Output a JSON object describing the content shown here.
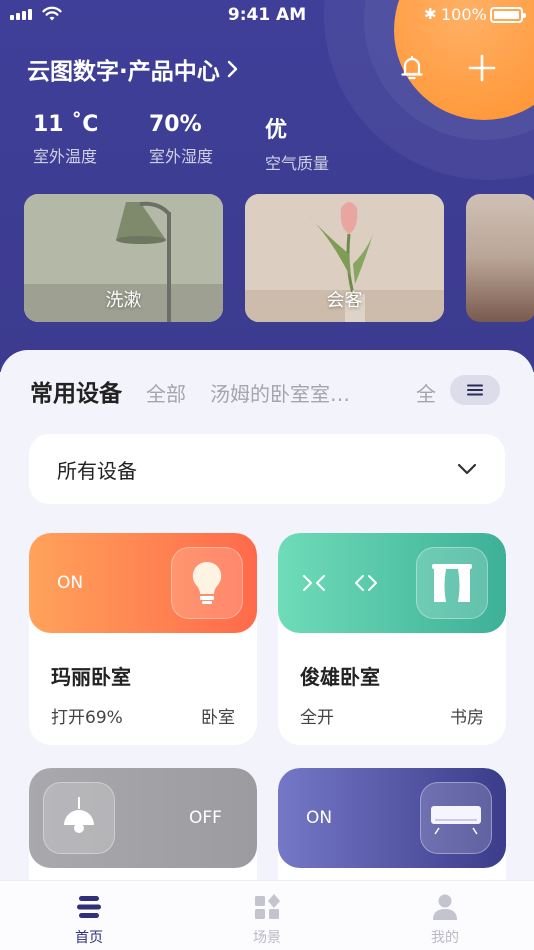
{
  "status_bar": {
    "time": "9:41 AM",
    "battery": "100%"
  },
  "header": {
    "location": "云图数字·产品中心",
    "weather": [
      {
        "value": "11 ˚C",
        "label": "室外温度"
      },
      {
        "value": "70%",
        "label": "室外湿度"
      },
      {
        "value": "优",
        "label": "空气质量"
      }
    ]
  },
  "scenes": [
    {
      "label": "洗漱"
    },
    {
      "label": "会客"
    }
  ],
  "tabs": {
    "active": "常用设备",
    "items": [
      "全部",
      "汤姆的卧室室…"
    ],
    "more": "全"
  },
  "filter": {
    "selected": "所有设备"
  },
  "devices": [
    {
      "state": "ON",
      "name": "玛丽卧室",
      "detail": "打开69%",
      "room": "卧室",
      "icon": "bulb-icon"
    },
    {
      "state": "",
      "name": "俊雄卧室",
      "detail": "全开",
      "room": "书房",
      "icon": "curtain-icon"
    },
    {
      "state": "OFF",
      "name": "",
      "detail": "",
      "room": "",
      "icon": "pendant-lamp-icon"
    },
    {
      "state": "ON",
      "name": "",
      "detail": "",
      "room": "",
      "icon": "air-conditioner-icon"
    }
  ],
  "nav": [
    {
      "label": "首页",
      "icon": "home-icon",
      "active": true
    },
    {
      "label": "场景",
      "icon": "scene-icon",
      "active": false
    },
    {
      "label": "我的",
      "icon": "profile-icon",
      "active": false
    }
  ],
  "colors": {
    "header_bg": "#3f3f99",
    "accent_orange": "#ff9a3c",
    "nav_active": "#2f2f7a"
  }
}
